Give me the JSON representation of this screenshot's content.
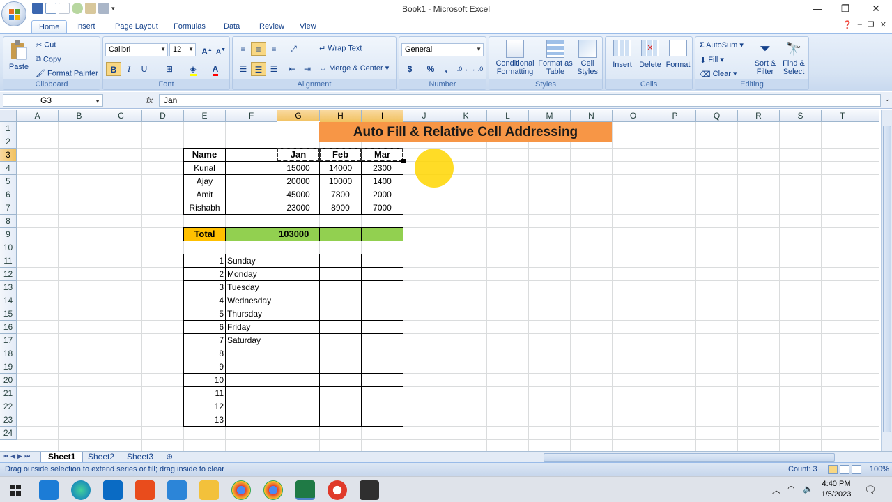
{
  "window": {
    "title": "Book1 - Microsoft Excel"
  },
  "tabs": [
    "Home",
    "Insert",
    "Page Layout",
    "Formulas",
    "Data",
    "Review",
    "View"
  ],
  "ribbon": {
    "clipboard": {
      "label": "Clipboard",
      "paste": "Paste",
      "cut": "Cut",
      "copy": "Copy",
      "format_painter": "Format Painter"
    },
    "font": {
      "label": "Font",
      "name": "Calibri",
      "size": "12",
      "bold": "B",
      "italic": "I",
      "underline": "U"
    },
    "alignment": {
      "label": "Alignment",
      "wrap_text": "Wrap Text",
      "merge_center": "Merge & Center"
    },
    "number": {
      "label": "Number",
      "format": "General",
      "currency": "$",
      "percent": "%",
      "comma": ","
    },
    "styles": {
      "label": "Styles",
      "conditional_formatting": "Conditional Formatting",
      "format_as_table": "Format as Table",
      "cell_styles": "Cell Styles"
    },
    "cells": {
      "label": "Cells",
      "insert": "Insert",
      "delete": "Delete",
      "format": "Format"
    },
    "editing": {
      "label": "Editing",
      "autosum": "AutoSum",
      "fill": "Fill",
      "clear": "Clear",
      "sort_filter": "Sort & Filter",
      "find_select": "Find & Select"
    }
  },
  "formula_bar": {
    "name_box": "G3",
    "fx": "fx",
    "value": "Jan"
  },
  "sheet": {
    "columns": [
      "A",
      "B",
      "C",
      "D",
      "E",
      "F",
      "G",
      "H",
      "I",
      "J",
      "K",
      "L",
      "M",
      "N",
      "O",
      "P",
      "Q",
      "R",
      "S",
      "T"
    ],
    "rows": [
      "1",
      "2",
      "3",
      "4",
      "5",
      "6",
      "7",
      "8",
      "9",
      "10",
      "11",
      "12",
      "13",
      "14",
      "15",
      "16",
      "17",
      "18",
      "19",
      "20",
      "21",
      "22",
      "23",
      "24"
    ],
    "banner": "Auto Fill & Relative Cell Addressing",
    "header": [
      "Name",
      "",
      "Jan",
      "Feb",
      "Mar"
    ],
    "data": [
      [
        "Kunal",
        "",
        "15000",
        "14000",
        "2300"
      ],
      [
        "Ajay",
        "",
        "20000",
        "10000",
        "1400"
      ],
      [
        "Amit",
        "",
        "45000",
        "7800",
        "2000"
      ],
      [
        "Rishabh",
        "",
        "23000",
        "8900",
        "7000"
      ]
    ],
    "total_label": "Total",
    "total_value": "103000",
    "series_numbers": [
      "1",
      "2",
      "3",
      "4",
      "5",
      "6",
      "7",
      "8",
      "9",
      "10",
      "11",
      "12",
      "13"
    ],
    "days": [
      "Sunday",
      "Monday",
      "Tuesday",
      "Wednesday",
      "Thursday",
      "Friday",
      "Saturday",
      "",
      "",
      "",
      "",
      "",
      ""
    ]
  },
  "sheet_tabs": [
    "Sheet1",
    "Sheet2",
    "Sheet3"
  ],
  "status": {
    "message": "Drag outside selection to extend series or fill; drag inside to clear",
    "count": "Count: 3",
    "zoom": "100%"
  },
  "taskbar": {
    "time": "4:40 PM",
    "date": "1/5/2023"
  },
  "colors": {
    "banner": "#f79646",
    "total_label": "#ffc000",
    "total_row": "#92d050",
    "selection_header": "#f5c86a"
  }
}
